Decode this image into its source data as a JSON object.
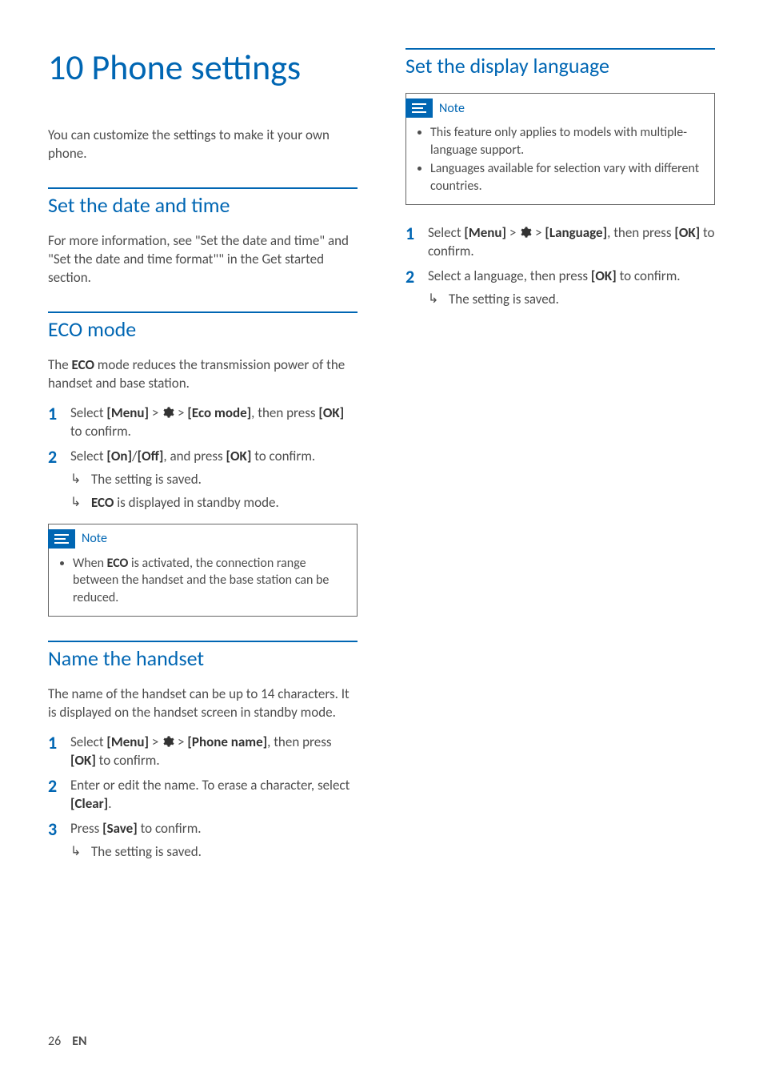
{
  "chapter": {
    "title": "10 Phone settings"
  },
  "intro": "You can customize the settings to make it your own phone.",
  "sections": {
    "date": {
      "heading": "Set the date and time",
      "body": "For more information, see \"Set the date and time\" and \"Set the date and time format\"\" in the Get started section."
    },
    "eco": {
      "heading": "ECO mode",
      "body_pre": "The ",
      "body_bold": "ECO",
      "body_post": " mode reduces the transmission power of the handset and base station.",
      "steps": [
        {
          "num": "1",
          "pre": "Select ",
          "b1": "[Menu]",
          "mid1": " > ",
          "gear": true,
          "mid2": " > ",
          "b2": "[Eco mode]",
          "post": ", then press ",
          "b3": "[OK]",
          "post2": " to confirm."
        },
        {
          "num": "2",
          "pre": "Select ",
          "b1": "[On]",
          "mid1": "/",
          "b2": "[Off]",
          "mid2": ", and press ",
          "b3": "[OK]",
          "post": " to confirm.",
          "results": [
            {
              "text": "The setting is saved."
            },
            {
              "bold": "ECO",
              "text": " is displayed in standby mode."
            }
          ]
        }
      ],
      "note": {
        "label": "Note",
        "items": [
          {
            "pre": "When ",
            "bold": "ECO",
            "post": " is activated, the connection range between the handset and the base station can be reduced."
          }
        ]
      }
    },
    "name": {
      "heading": "Name the handset",
      "body": "The name of the handset can be up to 14 characters. It is displayed on the handset screen in standby mode.",
      "steps": [
        {
          "num": "1",
          "pre": "Select ",
          "b1": "[Menu]",
          "mid1": " > ",
          "gear": true,
          "mid2": " > ",
          "b2": "[Phone name]",
          "post": ", then press ",
          "b3": "[OK]",
          "post2": " to confirm."
        },
        {
          "num": "2",
          "pre": "Enter or edit the name. To erase a character, select ",
          "b1": "[Clear]",
          "post": "."
        },
        {
          "num": "3",
          "pre": "Press ",
          "b1": "[Save]",
          "post": " to confirm.",
          "results": [
            {
              "text": "The setting is saved."
            }
          ]
        }
      ]
    },
    "lang": {
      "heading": "Set the display language",
      "note": {
        "label": "Note",
        "items": [
          {
            "text": "This feature only applies to models with multiple-language support."
          },
          {
            "text": "Languages available for selection vary with different countries."
          }
        ]
      },
      "steps": [
        {
          "num": "1",
          "pre": "Select ",
          "b1": "[Menu]",
          "mid1": " > ",
          "gear": true,
          "mid2": " > ",
          "b2": "[Language]",
          "post": ", then press ",
          "b3": "[OK]",
          "post2": " to confirm."
        },
        {
          "num": "2",
          "pre": "Select a language, then press ",
          "b1": "[OK]",
          "post": " to confirm.",
          "results": [
            {
              "text": "The setting is saved."
            }
          ]
        }
      ]
    }
  },
  "footer": {
    "page": "26",
    "lang": "EN"
  }
}
